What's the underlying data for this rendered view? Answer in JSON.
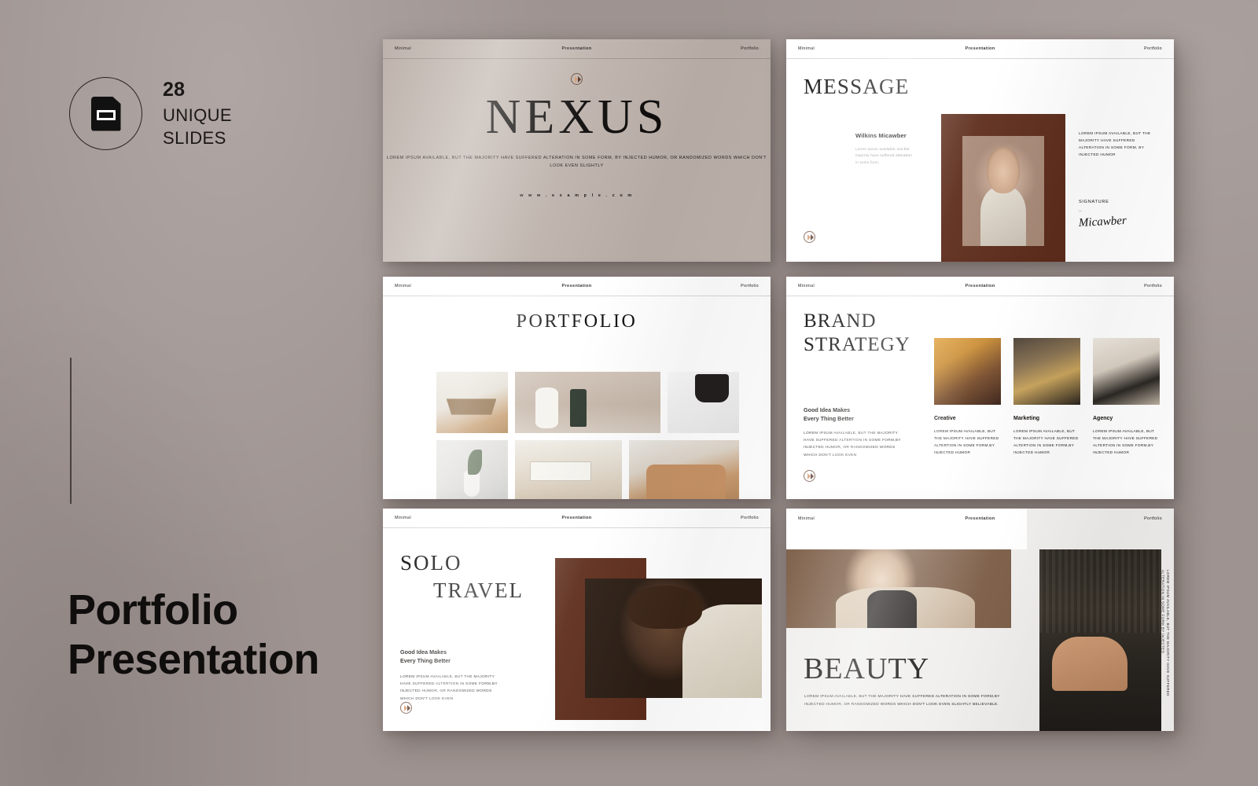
{
  "background": {
    "base_color": "#9e9390"
  },
  "left_panel": {
    "badge": {
      "icon": "slide-document-icon",
      "count": "28",
      "line1": "UNIQUE",
      "line2": "SLIDES"
    },
    "title_line1": "Portfolio",
    "title_line2": "Presentation"
  },
  "slide_header": {
    "left": "Minimal",
    "center": "Presentation",
    "right": "Portfolio"
  },
  "brand": {
    "logo_light": "#d49468",
    "logo_dark": "#4a2a1c",
    "accent_brown": "#5e2d1c"
  },
  "slides": [
    {
      "id": "nexus",
      "title": "NEXUS",
      "subtitle": "LOREM IPSUM AVAILABLE, BUT THE MAJORITY HAVE SUFFERED ALTERATION  IN SOME FORM, BY INJECTED HUMOR, OR RANDOMIZED WORDS WHICH DON'T LOOK EVEN SLIGHTLY",
      "url": "w w w . e x a m p l e . c o m"
    },
    {
      "id": "message",
      "title": "MESSAGE",
      "person_name": "Wilkins Micawber",
      "person_text": "Lorem Ipsum available, but the majority have suffered alteration in some form,",
      "right_text": "LOREM IPSUM AVAILABLE, BUT THE MAJORITY HAVE SUFFERED ALTERATION IN SOME FORM, BY INJECTED HUMOR",
      "signature_label": "SIGNATURE",
      "signature_dash": ":-",
      "signature_name": "Micawber"
    },
    {
      "id": "portfolio",
      "title": "PORTFOLIO"
    },
    {
      "id": "brand-strategy",
      "title_line1": "BRAND",
      "title_line2": "STRATEGY",
      "lead_heading_l1": "Good Idea Makes",
      "lead_heading_l2": "Every Thing Better",
      "lead_body": "LOREM IPSUM AVAILABLE, BUT THE MAJORITY HAVE SUFFERED ALTERTION IN SOME FORM,BY INJECTED HUMOR, OR RANDOMIZED WORDS WHICH DON'T LOOK EVEN",
      "columns": [
        {
          "name": "Creative",
          "body": "LOREM IPSUM AVAILABLE, BUT THE MAJORITY HAVE SUFFERED ALTERTION IN SOME FORM,BY INJECTED HUMOR"
        },
        {
          "name": "Marketing",
          "body": "LOREM IPSUM AVAILABLE, BUT THE MAJORITY HAVE SUFFERED ALTERTION IN SOME FORM,BY INJECTED HUMOR"
        },
        {
          "name": "Agency",
          "body": "LOREM IPSUM AVAILABLE, BUT THE MAJORITY HAVE SUFFERED ALTERTION IN SOME FORM,BY INJECTED HUMOR"
        }
      ]
    },
    {
      "id": "solo-travel",
      "title_line1": "SOLO",
      "title_line2": "TRAVEL",
      "lead_heading_l1": "Good Idea Makes",
      "lead_heading_l2": "Every Thing Better",
      "lead_body": "LOREM IPSUM AVAILABLE, BUT THE MAJORITY HAVE SUFFERED ALTERTION IN SOME FORM,BY INJECTED HUMOR, OR RANDOMIZED WORDS WHICH DON'T LOOK EVEN"
    },
    {
      "id": "beauty",
      "title": "BEAUTY",
      "body": "LOREM IPSUM AVAILABLE, BUT THE MAJORITY HAVE SUFFERED ALTERATION IN SOME FORM,BY INJECTED HUMOR, OR RANDOMIZED WORDS WHICH DON'T LOOK EVEN SLIGHTLY BELIEVABLE.",
      "vertical_text": "LOREM IPSUM AVAILABLE, BUT THE MAJORITY HAVE SUFFERED ALTERATION IN SOME FORM BY INJECTED"
    }
  ]
}
